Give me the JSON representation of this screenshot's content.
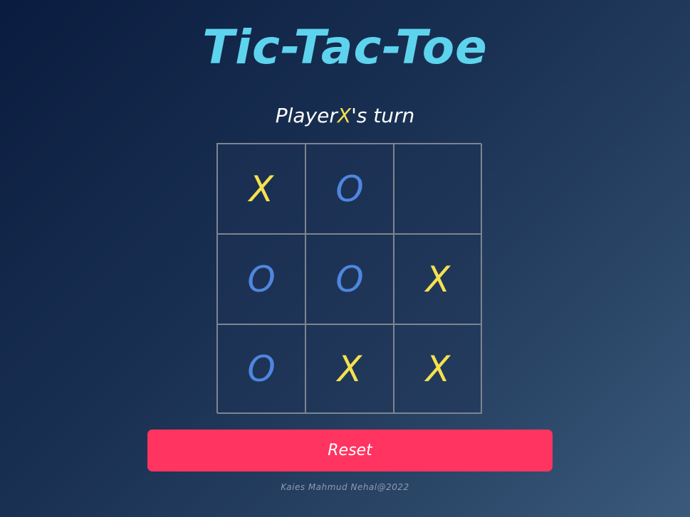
{
  "title": "Tic-Tac-Toe",
  "status": {
    "prefix": "Player",
    "player": "X",
    "suffix": "'s turn"
  },
  "board": [
    [
      "X",
      "O",
      ""
    ],
    [
      "O",
      "O",
      "X"
    ],
    [
      "O",
      "X",
      "X"
    ]
  ],
  "reset_label": "Reset",
  "footer": "Kaies Mahmud Nehal@2022",
  "colors": {
    "title": "#5ed3ee",
    "x_mark": "#f5e14f",
    "o_mark": "#4f86e0",
    "reset_button": "#ff3460"
  }
}
